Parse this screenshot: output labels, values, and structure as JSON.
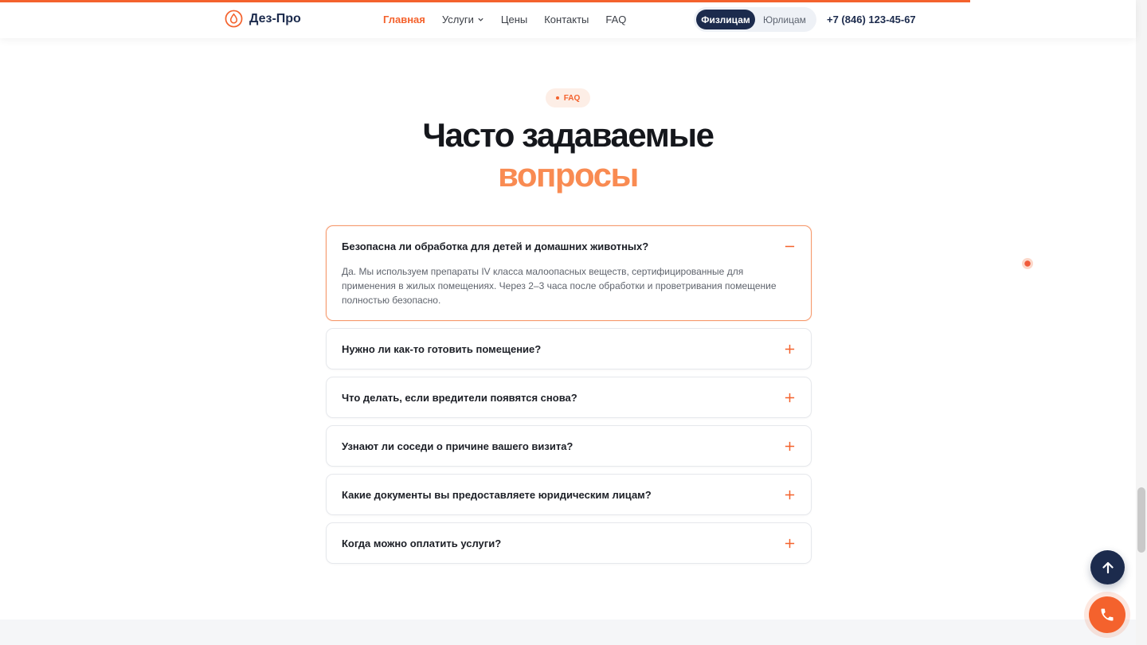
{
  "header": {
    "logo_text": "Дез-Про",
    "nav": [
      {
        "label": "Главная",
        "active": true
      },
      {
        "label": "Услуги",
        "dropdown": true
      },
      {
        "label": "Цены"
      },
      {
        "label": "Контакты"
      },
      {
        "label": "FAQ"
      }
    ],
    "audience_toggle": {
      "options": [
        "Физлицам",
        "Юрлицам"
      ],
      "selected": "Физлицам"
    },
    "phone": "+7 (846) 123-45-67"
  },
  "section": {
    "badge": "FAQ",
    "title_line1": "Часто задаваемые",
    "title_line2": "вопросы"
  },
  "faq": [
    {
      "question": "Безопасна ли обработка для детей и домашних животных?",
      "answer": "Да. Мы используем препараты IV класса малоопасных веществ, сертифицированные для применения в жилых помещениях. Через 2–3 часа после обработки и проветривания помещение полностью безопасно.",
      "open": true
    },
    {
      "question": "Нужно ли как-то готовить помещение?",
      "open": false
    },
    {
      "question": "Что делать, если вредители появятся снова?",
      "open": false
    },
    {
      "question": "Узнают ли соседи о причине вашего визита?",
      "open": false
    },
    {
      "question": "Какие документы вы предоставляете юридическим лицам?",
      "open": false
    },
    {
      "question": "Когда можно оплатить услуги?",
      "open": false
    }
  ],
  "icons": {
    "logo": "drop-icon",
    "expand": "plus-icon",
    "collapse": "minus-icon",
    "scroll_top": "arrow-up-icon",
    "call": "phone-icon"
  },
  "colors": {
    "accent": "#f4622d",
    "accent_light": "#f98b52",
    "navy": "#1c2b4d"
  },
  "scroll_progress": 0.846
}
